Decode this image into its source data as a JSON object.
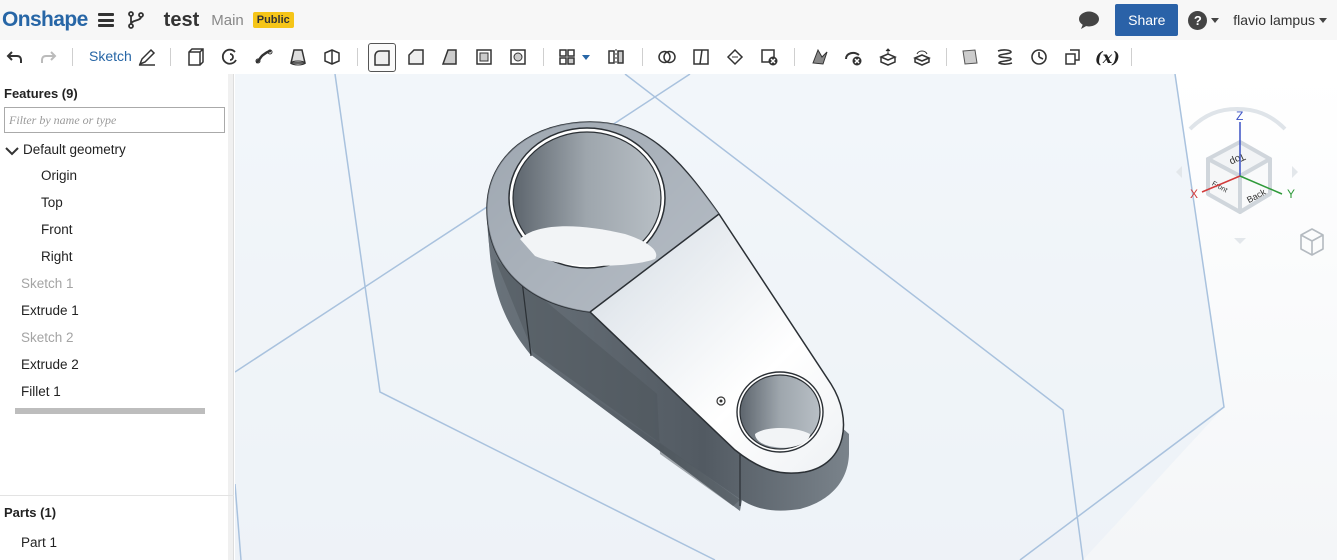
{
  "header": {
    "logo": "Onshape",
    "document_title": "test",
    "workspace": "Main",
    "badge": "Public",
    "share_label": "Share",
    "help_label": "?",
    "user_name": "flavio lampus"
  },
  "toolbar": {
    "sketch_label": "Sketch",
    "variable_label": "(x)"
  },
  "features": {
    "header": "Features (9)",
    "filter_placeholder": "Filter by name or type",
    "group": "Default geometry",
    "items": [
      {
        "label": "Origin",
        "dim": false
      },
      {
        "label": "Top",
        "dim": false
      },
      {
        "label": "Front",
        "dim": false
      },
      {
        "label": "Right",
        "dim": false
      },
      {
        "label": "Sketch 1",
        "dim": true
      },
      {
        "label": "Extrude 1",
        "dim": false
      },
      {
        "label": "Sketch 2",
        "dim": true
      },
      {
        "label": "Extrude 2",
        "dim": false
      },
      {
        "label": "Fillet 1",
        "dim": false
      }
    ]
  },
  "parts": {
    "header": "Parts (1)",
    "items": [
      {
        "label": "Part 1"
      }
    ]
  },
  "viewcube": {
    "axis_x": "X",
    "axis_y": "Y",
    "axis_z": "Z",
    "face_top": "Top",
    "face_front": "Front",
    "face_back": "Back"
  },
  "colors": {
    "brand": "#2766a6",
    "share": "#2a62a8",
    "badge": "#f5c518",
    "plane": "#a9c2de"
  }
}
